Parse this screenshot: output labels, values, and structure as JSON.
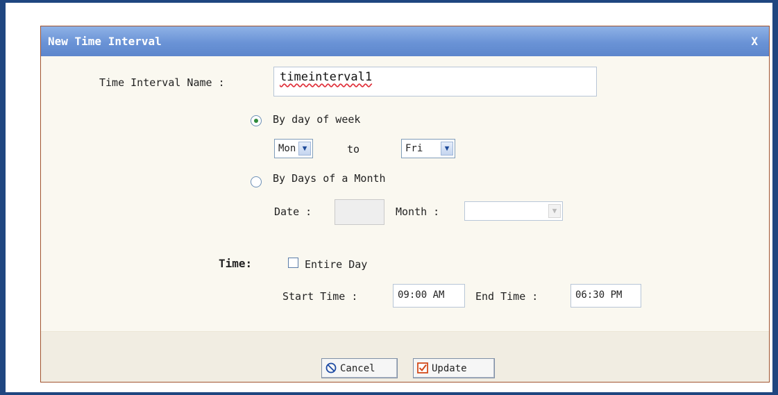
{
  "dialog": {
    "title": "New Time Interval",
    "close_label": "X"
  },
  "form": {
    "name_label": "Time Interval Name :",
    "name_value": "timeinterval1",
    "by_day_of_week": {
      "label": "By day of week",
      "selected": true,
      "from_value": "Mon",
      "to_label": "to",
      "to_value": "Fri"
    },
    "by_days_of_month": {
      "label": "By Days of a Month",
      "selected": false,
      "date_label": "Date :",
      "date_value": "",
      "month_label": "Month :",
      "month_value": ""
    },
    "time": {
      "section_label": "Time:",
      "entire_day_label": "Entire Day",
      "entire_day_checked": false,
      "start_label": "Start Time :",
      "start_value": "09:00 AM",
      "end_label": "End Time :",
      "end_value": "06:30 PM"
    }
  },
  "buttons": {
    "cancel_label": "Cancel",
    "update_label": "Update"
  },
  "icons": {
    "close": "close-icon",
    "cancel": "cancel-icon",
    "update": "checkbox-checked-icon",
    "dropdown": "chevron-down-icon"
  },
  "colors": {
    "frame_border": "#1f4680",
    "titlebar": "#6a93d6",
    "dialog_border": "#a0522d",
    "radio_selected": "#2e8b3a"
  }
}
